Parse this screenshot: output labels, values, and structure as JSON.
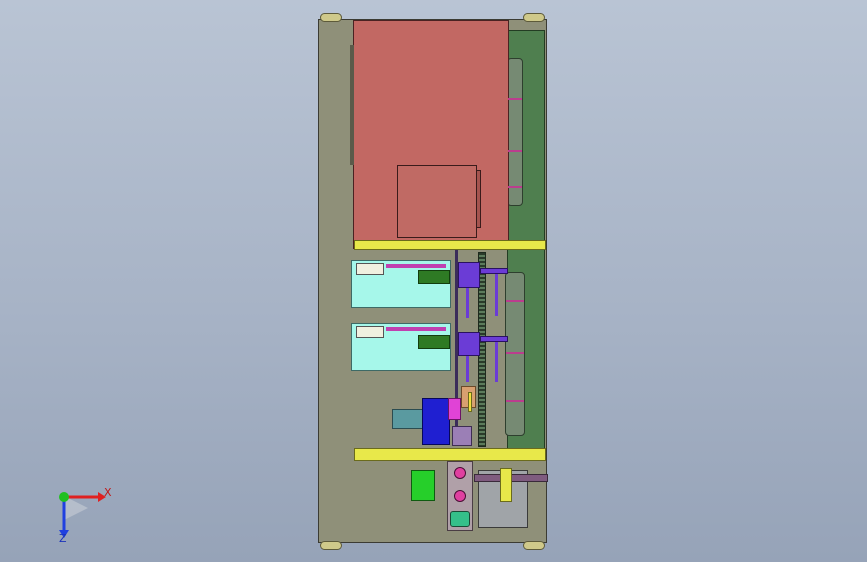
{
  "viewport": {
    "background_colors": [
      "#b9c4d4",
      "#96a3b8"
    ]
  },
  "model": {
    "colors": {
      "frame": "#8f9079",
      "upper_plate": "#c26863",
      "rail": "#4f7f4f",
      "bar": "#e8e84a",
      "cyan": "#a6f7ea",
      "purple": "#6b3cd6",
      "blue": "#1f1fd1"
    }
  },
  "triad": {
    "x_label": "X",
    "z_label": "Z",
    "colors": {
      "x": "#e02020",
      "y": "#20c020",
      "z": "#2040e0"
    }
  }
}
